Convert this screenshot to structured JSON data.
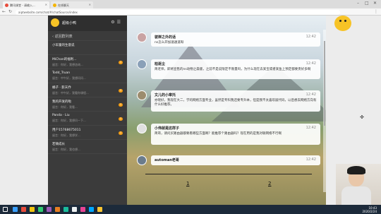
{
  "browser": {
    "tabs": [
      {
        "label": "腾讯课堂 - 请输入..."
      },
      {
        "label": "在线聊天"
      }
    ],
    "url": "aiptwebsite.com/chat/#/chatSource/index"
  },
  "sidebar": {
    "user_name": "超级小鸭",
    "back_label": "返回群列表",
    "items": [
      {
        "name": "小军童的生意说",
        "preview": "",
        "badge": ""
      },
      {
        "name": "MiChan的福利...",
        "preview": "留言：你好，我想咨询...",
        "badge": "1"
      },
      {
        "name": "Todd_Truan",
        "preview": "留言：中午好，我想问问...",
        "badge": ""
      },
      {
        "name": "橘子 · 影天乔",
        "preview": "留言：中午好，我看你课程...",
        "badge": "1"
      },
      {
        "name": "我的开发的啦",
        "preview": "留言：你好，我看...",
        "badge": "1"
      },
      {
        "name": "Panda · Liu",
        "preview": "留言：你好，我想问一下...",
        "badge": "1"
      },
      {
        "name": "用户15768675011",
        "preview": "留言：你好，我想学...",
        "badge": "1"
      },
      {
        "name": "若微成长",
        "preview": "留言：你好，我也想...",
        "badge": ""
      }
    ]
  },
  "messages": [
    {
      "name": "彼岸之外的话",
      "time": "12:42",
      "text": "ns怎么开加速通道呀"
    },
    {
      "name": "柏逐尘",
      "time": "12:42",
      "text": "简老师，即将宣售的ns动物之森版，之前不是说限定不限量吗，为什么现在去某宝或者某鱼上预定都要贵好多啊"
    },
    {
      "name": "文儿的小章托",
      "time": "12:42",
      "text": "亦晓好，我现在大二，学的网络方面专业，虽然是专科我还要专升本，但是我不太喜欢敲代码，以后想去网络方向有什么好推荐。"
    },
    {
      "name": "小伟就是这样子",
      "time": "12:42",
      "text": "简哥，请问买路由器都要看哪些方面啊？能推荐个路由器吗？现在用的是我对联网络不行啊"
    },
    {
      "name": "automan老哥",
      "time": "12:42",
      "text": ""
    }
  ],
  "pagination": {
    "page1": "1",
    "page2": "2"
  },
  "taskbar": {
    "time": "10:43",
    "date": "2020/2/24"
  }
}
